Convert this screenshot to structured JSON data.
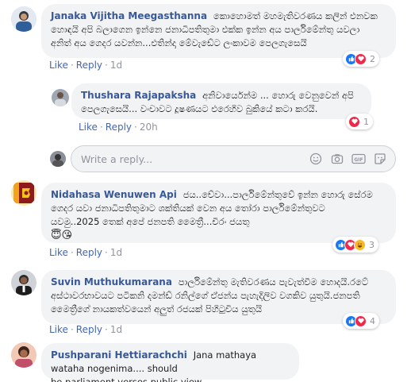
{
  "comments": [
    {
      "author": "Janaka Vijitha Meegasthanna",
      "text_line1": "කොහොමත් මහමැතිවරණය කලින් එනවක",
      "text_line2": "හොඳයි අපි බලාගෙන ඉන්නෙ ජනාධිපතිතුමා එක්ක ඉන්න අය පාර්ලිමේන්තු යවලා",
      "text_line3": "අනිත් අය ගෙදර යවන්න...එතින්දා මේවැඩේට ලංකාවම පෙලගැසෙයි",
      "like": "Like",
      "reply": "Reply",
      "time": "1d",
      "reaction_count": "2"
    },
    {
      "author": "Thushara Rajapaksha",
      "text_line1": "අනිවාර්යෙන්ම ... හොරු වෙනුවෙන් අපි",
      "text_line2": "පෙලගැසෙයි... වංචාවට දූෂණයට එරෙහිව බුකියේ කටා කරයි.",
      "like": "Like",
      "reply": "Reply",
      "time": "20h",
      "reaction_count": "1"
    },
    {
      "author": "Nidahasa Wenuwen Api",
      "text_line1": "ජය..චේවා...පාර්ලිමේන්තුවේ ඉන්න හොරු සේරම",
      "text_line2": "ගෙදර යවා ජනාධිපතිතුමාට ශක්තියක් වෙන අය තෝරා පාර්ලිමේන්තුවට",
      "text_line3": "යවමු..2025 තෙක් අපේ ජනපති මෛත්‍රී...චිරං ජයතු",
      "emojis": "😇😘",
      "like": "Like",
      "reply": "Reply",
      "time": "1d",
      "reaction_count": "3"
    },
    {
      "author": "Suvin Muthukumarana",
      "text_line1": "පාර්ලිමේන්තු මැතිවරණය පැවැත්වීම හොදයි.රටේ",
      "text_line2": "අස්ථාවරභාවයට පටිකනි දමන්ඩ් රනිල්ගේ ඒජන්ය පැහැදිලිව වගකිව යුතුයි.ජනපති",
      "text_line3": "මෛත්‍රීගේ නායකත්වයෙන් අලුත් රජයක් පිහිටුවිය යුතුයි",
      "like": "Like",
      "reply": "Reply",
      "time": "1d",
      "reaction_count": "4"
    },
    {
      "author": "Pushparani Hettiarachchi",
      "text_line1": "Jana mathaya wataha nogenima.... should",
      "text_line2": "be parliament verses public view..."
    }
  ],
  "reply_box": {
    "placeholder": "Write a reply..."
  },
  "icons": [
    "emoji-icon",
    "camera-icon",
    "gif-icon",
    "sticker-icon"
  ],
  "colors": {
    "author": "#385898",
    "like": "#1877f2",
    "love": "#f02849",
    "haha": "#f7b928",
    "bubble": "#f2f3f5"
  }
}
